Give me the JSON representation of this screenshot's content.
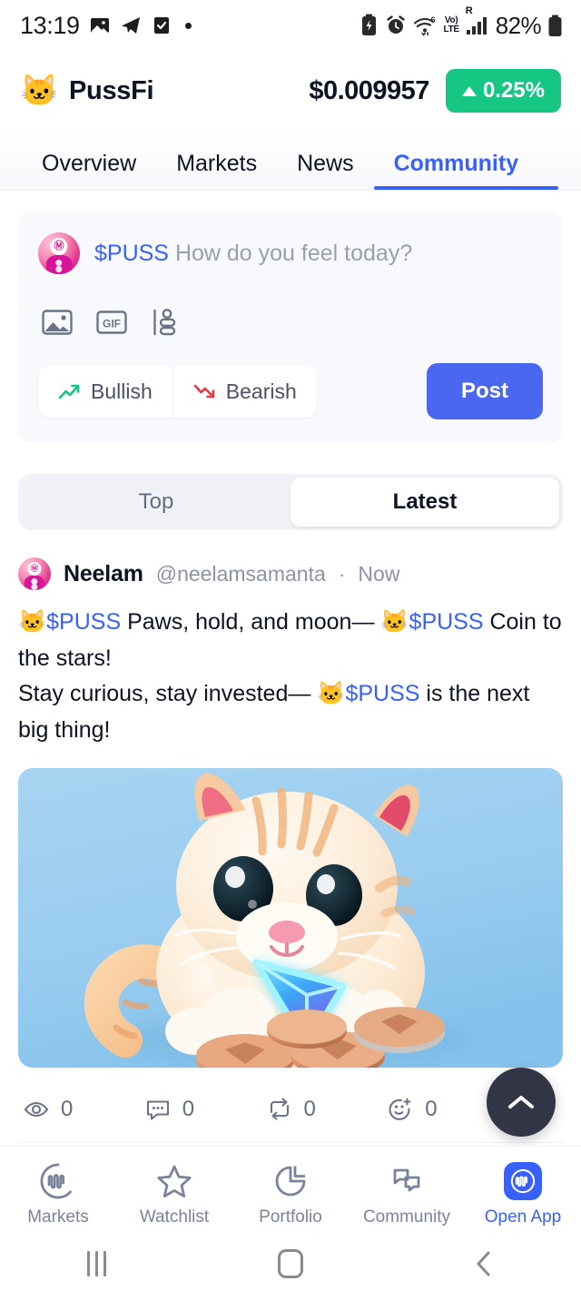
{
  "status_bar": {
    "time": "13:19",
    "left_icons": [
      "photo-icon",
      "telegram-icon",
      "task-done-icon",
      "dot-indicator"
    ],
    "network_volte": "Vo)",
    "network_lte": "LTE",
    "roaming": "R",
    "wifi_gen": "6",
    "battery_percent": "82%",
    "right_icons": [
      "battery-saver-icon",
      "alarm-icon",
      "wifi-icon",
      "volte-icon",
      "signal-icon",
      "battery-icon"
    ]
  },
  "header": {
    "coin_logo": "🐱",
    "coin_name": "PussFi",
    "price": "$0.009957",
    "change": "0.25%",
    "change_direction": "up",
    "change_color": "#16C784"
  },
  "tabs": [
    {
      "label": "Overview",
      "active": false
    },
    {
      "label": "Markets",
      "active": false
    },
    {
      "label": "News",
      "active": false
    },
    {
      "label": "Community",
      "active": true
    }
  ],
  "accent_color": "#3861FB",
  "composer": {
    "ticker": "$PUSS",
    "placeholder": "How do you feel today?",
    "icons": [
      "image-icon",
      "gif-icon",
      "poll-icon"
    ],
    "bullish_label": "Bullish",
    "bearish_label": "Bearish",
    "bullish_color": "#16C784",
    "bearish_color": "#EA3943",
    "post_label": "Post",
    "post_button_color": "#4B66EF"
  },
  "feed_filter": {
    "options": [
      {
        "label": "Top",
        "active": false
      },
      {
        "label": "Latest",
        "active": true
      }
    ]
  },
  "post": {
    "author_name": "Neelam",
    "author_handle": "@neelamsamanta",
    "separator": "·",
    "timestamp": "Now",
    "body_segments": [
      {
        "type": "emoji",
        "text": "🐱"
      },
      {
        "type": "cashtag",
        "text": "$PUSS"
      },
      {
        "type": "text",
        "text": " Paws, hold, and moon— "
      },
      {
        "type": "emoji",
        "text": "🐱"
      },
      {
        "type": "cashtag",
        "text": "$PUSS"
      },
      {
        "type": "text",
        "text": " Coin to the stars!"
      },
      {
        "type": "break",
        "text": ""
      },
      {
        "type": "text",
        "text": "Stay curious, stay invested— "
      },
      {
        "type": "emoji",
        "text": "🐱"
      },
      {
        "type": "cashtag",
        "text": "$PUSS"
      },
      {
        "type": "text",
        "text": " is the next big thing!"
      }
    ],
    "image_alt": "3D kitten holding a glowing TRON crystal with copper coins",
    "actions": [
      {
        "icon": "eye-icon",
        "count": "0"
      },
      {
        "icon": "comment-icon",
        "count": "0"
      },
      {
        "icon": "repost-icon",
        "count": "0"
      },
      {
        "icon": "reaction-icon",
        "count": "0"
      }
    ],
    "more_icon": "ellipsis-icon"
  },
  "scroll_top": {
    "icon": "chevron-up-icon"
  },
  "bottom_nav": [
    {
      "label": "Markets",
      "icon": "cmc-logo-icon",
      "active": false
    },
    {
      "label": "Watchlist",
      "icon": "star-icon",
      "active": false
    },
    {
      "label": "Portfolio",
      "icon": "pie-chart-icon",
      "active": false
    },
    {
      "label": "Community",
      "icon": "chat-bubbles-icon",
      "active": false
    },
    {
      "label": "Open App",
      "icon": "cmc-app-icon",
      "active": true
    }
  ],
  "android_nav": [
    "recents-button",
    "home-button",
    "back-button"
  ]
}
